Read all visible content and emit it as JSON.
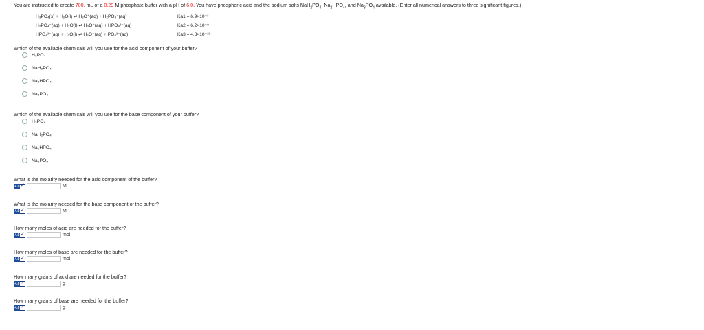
{
  "intro": {
    "p1": "You are instructed to create ",
    "volume": "700.",
    "p2": " mL of a ",
    "molarity": "0.29",
    "p3": " M phosphate buffer with a pH of ",
    "ph": "6.0",
    "p4": ". You have phosphoric acid and the sodium salts NaH",
    "p5": "PO",
    "p6": ", Na",
    "p7": "HPO",
    "p8": ", and Na",
    "p9": "PO",
    "p10": " available. (Enter all numerical answers to three significant figures.)"
  },
  "equations": [
    {
      "text": "H₃PO₄(s) + H₂O(l) ⇌ H₃O⁺(aq) + H₂PO₄⁻(aq)",
      "k": "Ka1 = 6.9×10⁻³"
    },
    {
      "text": "H₂PO₄⁻(aq) + H₂O(l) ⇌ H₃O⁺(aq) + HPO₄²⁻(aq)",
      "k": "Ka2 = 6.2×10⁻⁸"
    },
    {
      "text": "HPO₄²⁻(aq) + H₂O(l) ⇌ H₃O⁺(aq) + PO₄³⁻(aq)",
      "k": "Ka3 = 4.8×10⁻¹³"
    }
  ],
  "acid_question": "Which of the available chemicals will you use for the acid component of your buffer?",
  "base_question": "Which of the available chemicals will you use for the base component of your buffer?",
  "options": [
    "H₃PO₄",
    "NaH₂PO₄",
    "Na₂HPO₄",
    "Na₃PO₄"
  ],
  "numeric_questions": [
    {
      "label": "What is the molarity needed for the acid component of the buffer?",
      "unit": "M",
      "badge": "4.0"
    },
    {
      "label": "What is the molarity needed for the base component of the buffer?",
      "unit": "M",
      "badge": "4.0"
    },
    {
      "label": "How many moles of acid are needed for the buffer?",
      "unit": "mol",
      "badge": "4.0"
    },
    {
      "label": "How many moles of base are needed for the buffer?",
      "unit": "mol",
      "badge": "4.0"
    },
    {
      "label": "How many grams of acid are needed for the buffer?",
      "unit": "g",
      "badge": "4.0"
    },
    {
      "label": "How many grams of base are needed for the buffer?",
      "unit": "g",
      "badge": "4.0"
    }
  ],
  "colors": {
    "accent_red": "#d92b2b",
    "badge_blue": "#1f4e9b"
  },
  "icons": {
    "badge": "checkmark-icon",
    "radio": "radio-icon"
  }
}
